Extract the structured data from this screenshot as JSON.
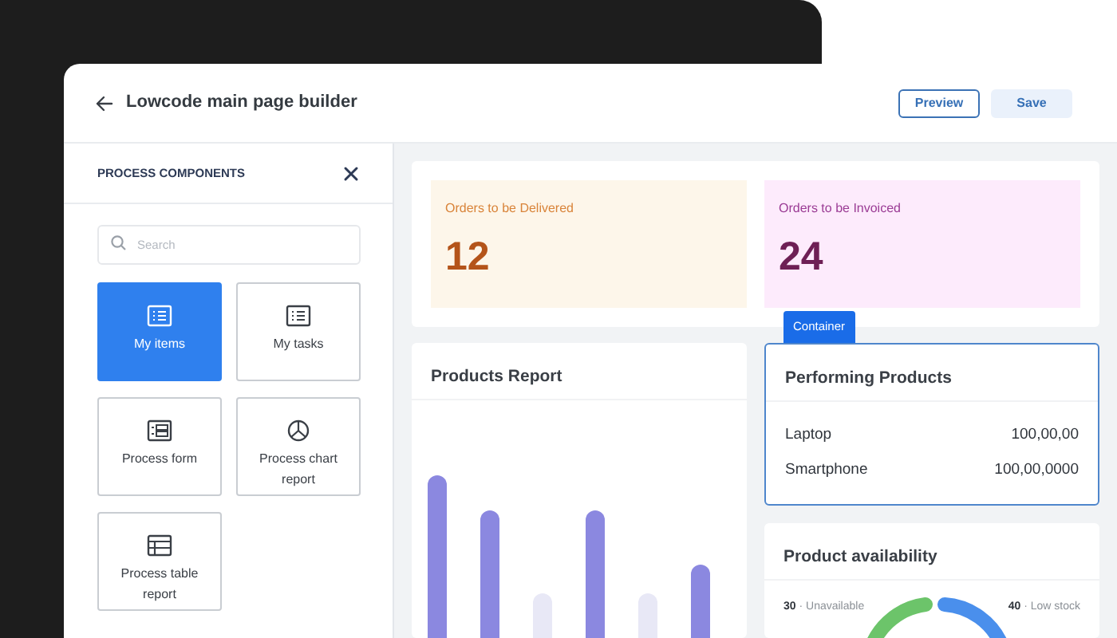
{
  "header": {
    "title": "Lowcode main page builder",
    "buttons": [
      {
        "label": "Preview",
        "kind": "outline"
      },
      {
        "label": "Save",
        "kind": "soft"
      }
    ]
  },
  "sidebar": {
    "title": "PROCESS COMPONENTS",
    "search": {
      "placeholder": "Search"
    },
    "components": [
      {
        "label": "My items",
        "selected": true
      },
      {
        "label": "My tasks",
        "selected": false
      },
      {
        "label": "Process form",
        "selected": false
      },
      {
        "label": "Process chart report",
        "selected": false
      },
      {
        "label": "Process table report",
        "selected": false
      }
    ]
  },
  "stats": [
    {
      "label": "Orders to be Delivered",
      "value": "12",
      "color": "#fdf6ea"
    },
    {
      "label": "Orders to be Invoiced",
      "value": "24",
      "color": "#fdebfc"
    }
  ],
  "products_report": {
    "title": "Products Report"
  },
  "container_tag": "Container",
  "performing_products": {
    "title": "Performing Products",
    "rows": [
      {
        "name": "Laptop",
        "value": "100,00,00"
      },
      {
        "name": "Smartphone",
        "value": "100,00,0000"
      }
    ]
  },
  "availability": {
    "title": "Product availability",
    "legend": [
      "**30** · Unavailable",
      "**40** · Low stock"
    ]
  }
}
